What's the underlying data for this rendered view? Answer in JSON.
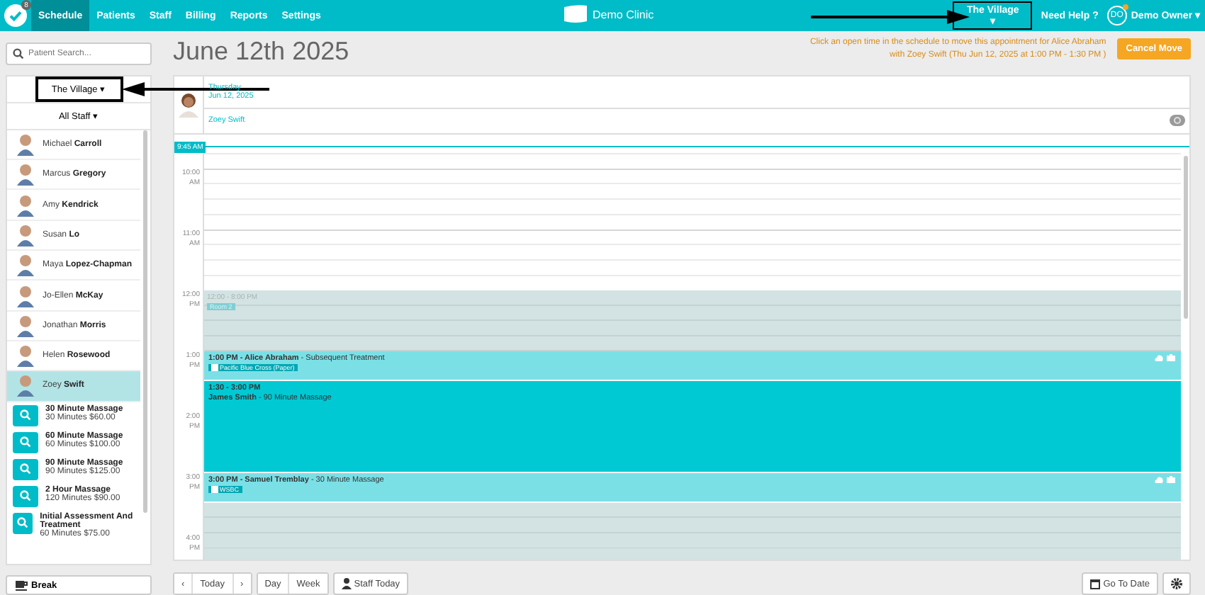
{
  "nav": {
    "badge": "8",
    "tabs": [
      {
        "label": "Schedule",
        "selected": true
      },
      {
        "label": "Patients",
        "selected": false
      },
      {
        "label": "Staff",
        "selected": false
      },
      {
        "label": "Billing",
        "selected": false
      },
      {
        "label": "Reports",
        "selected": false
      },
      {
        "label": "Settings",
        "selected": false
      }
    ],
    "clinic": "Demo Clinic",
    "location": {
      "label": "The Village ▾",
      "highlighted": true
    },
    "help": "Need Help ?",
    "user_initials": "DO",
    "user_notification": true,
    "user": "Demo Owner ▾"
  },
  "sidebar": {
    "search": {
      "placeholder": "Patient Search..."
    },
    "location": {
      "label": "The Village ▾",
      "highlighted": true
    },
    "staff_filter": "All Staff ▾",
    "staff": [
      {
        "name": "Michael **Carroll**",
        "selected": false
      },
      {
        "name": "Marcus **Gregory**",
        "selected": false
      },
      {
        "name": "Amy **Kendrick**",
        "selected": false
      },
      {
        "name": "Susan **Lo**",
        "selected": false
      },
      {
        "name": "Maya **Lopez-Chapman**",
        "selected": false
      },
      {
        "name": "Jo-Ellen **McKay**",
        "selected": false
      },
      {
        "name": "Jonathan **Morris**",
        "selected": false
      },
      {
        "name": "Helen **Rosewood**",
        "selected": false
      },
      {
        "name": "Zoey **Swift**",
        "selected": true
      }
    ],
    "services": [
      {
        "title": "30 Minute Massage",
        "detail": "30 Minutes $60.00"
      },
      {
        "title": "60 Minute Massage",
        "detail": "60 Minutes $100.00"
      },
      {
        "title": "90 Minute Massage",
        "detail": "90 Minutes $125.00"
      },
      {
        "title": "2 Hour Massage",
        "detail": "120 Minutes $90.00"
      },
      {
        "title": "Initial Assessment And Treatment",
        "detail": "60 Minutes $75.00"
      }
    ],
    "break_button": "Break"
  },
  "schedule": {
    "title": "June 12th 2025",
    "notice": [
      "Click an open time in the schedule to move this appointment for Alice Abraham",
      "with Zoey Swift (Thu Jun 12, 2025 at 1:00 PM - 1:30 PM )"
    ],
    "cancel_button": "Cancel Move",
    "day": "Thursday",
    "date": "Jun 12, 2025",
    "staff_name": "Zoey Swift",
    "now": "9:45 AM",
    "hours": [
      "10:00 AM",
      "11:00 AM",
      "12:00 PM",
      "1:00 PM",
      "2:00 PM",
      "3:00 PM",
      "4:00 PM"
    ],
    "events": [
      {
        "kind": "unavailable",
        "time": "12:00 - 8:00 PM",
        "tag": "Room 2"
      },
      {
        "kind": "appointment",
        "color": "#7ae0e6",
        "title": "**1:00 PM - Alice Abraham** - Subsequent Treatment",
        "tag": "Pacific Blue Cross (Paper)",
        "icons": true
      },
      {
        "kind": "appointment",
        "color": "#00c9d4",
        "time": "1:30 - 3:00 PM",
        "title": "**James Smith** - 90 Minute Massage",
        "icons": false
      },
      {
        "kind": "appointment",
        "color": "#7ae0e6",
        "title": "**3:00 PM - Samuel Tremblay** - 30 Minute Massage",
        "tag": "WSBC",
        "icons": true
      }
    ]
  },
  "toolbar": {
    "prev": "‹",
    "today": "Today",
    "next": "›",
    "day": "Day",
    "week": "Week",
    "staff_today": "Staff Today",
    "go_to_date": "Go To Date"
  }
}
